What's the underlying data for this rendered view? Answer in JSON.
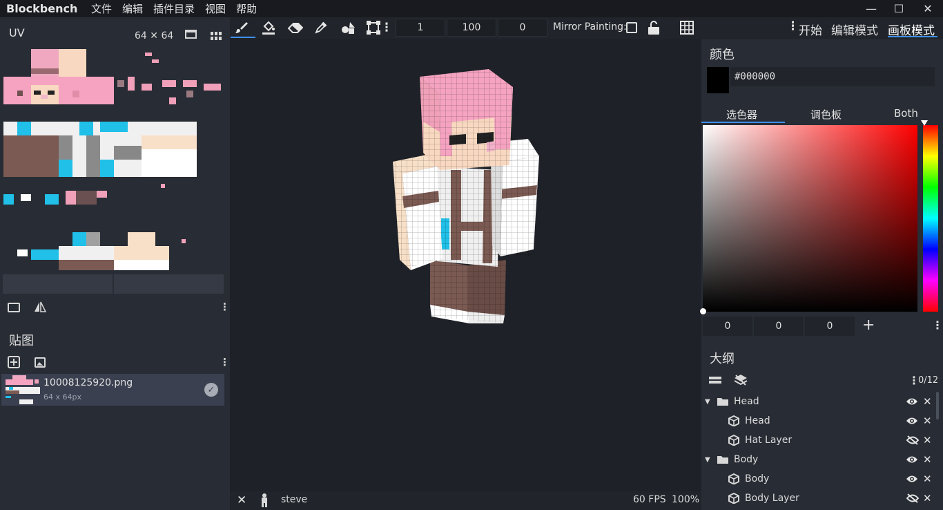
{
  "app": {
    "title": "Blockbench",
    "menu": [
      "文件",
      "编辑",
      "插件目录",
      "视图",
      "帮助"
    ],
    "window_controls": {
      "minimize": "—",
      "maximize": "☐",
      "close": "✕"
    }
  },
  "uv_panel": {
    "title": "UV",
    "size_label": "64 ✕ 64"
  },
  "textures_panel": {
    "title": "贴图",
    "items": [
      {
        "name": "10008125920.png",
        "size": "64 x 64px"
      }
    ]
  },
  "toolbar": {
    "brush_size": "1",
    "opacity": "100",
    "softness": "0",
    "mirror_label": "Mirror Painting:"
  },
  "modes": {
    "start": "开始",
    "edit": "编辑模式",
    "paint": "画板模式"
  },
  "color_panel": {
    "title": "颜色",
    "hex": "#000000",
    "tabs": [
      "选色器",
      "调色板",
      "Both"
    ],
    "rgb": [
      "0",
      "0",
      "0"
    ],
    "hue_color": "#ff0000"
  },
  "outliner": {
    "title": "大纲",
    "count": "0/12",
    "rows": [
      {
        "label": "Head",
        "type": "group",
        "visible": true
      },
      {
        "label": "Head",
        "type": "cube",
        "visible": true
      },
      {
        "label": "Hat Layer",
        "type": "cube",
        "visible": false
      },
      {
        "label": "Body",
        "type": "group",
        "visible": true
      },
      {
        "label": "Body",
        "type": "cube",
        "visible": true
      },
      {
        "label": "Body Layer",
        "type": "cube",
        "visible": false
      }
    ]
  },
  "status": {
    "model_name": "steve",
    "fps": "60 FPS",
    "zoom": "100%"
  }
}
